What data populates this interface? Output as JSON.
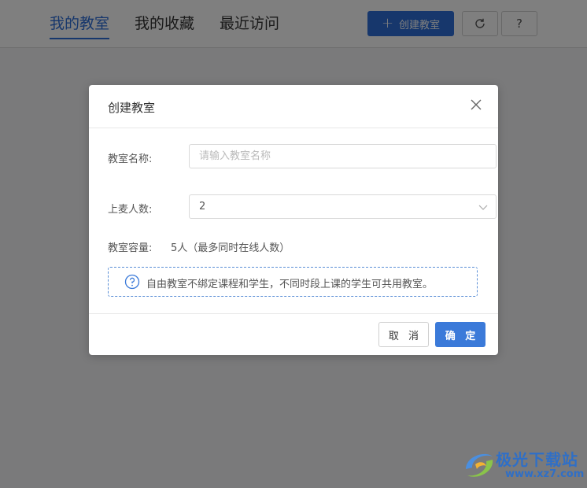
{
  "header": {
    "tabs": [
      {
        "label": "我的教室",
        "active": true
      },
      {
        "label": "我的收藏",
        "active": false
      },
      {
        "label": "最近访问",
        "active": false
      }
    ],
    "create_button_label": "创建教室",
    "refresh_icon": "refresh-icon",
    "help_label": "?"
  },
  "modal": {
    "title": "创建教室",
    "name_label": "教室名称:",
    "name_placeholder": "请输入教室名称",
    "name_value": "",
    "seats_label": "上麦人数:",
    "seats_value": "2",
    "capacity_label": "教室容量:",
    "capacity_value": "5人（最多同时在线人数）",
    "notice": "自由教室不绑定课程和学生，不同时段上课的学生可共用教室。",
    "cancel_label": "取 消",
    "ok_label": "确 定"
  },
  "watermark": {
    "name": "极光下载站",
    "url": "www.xz7.com"
  },
  "colors": {
    "accent": "#2e6fd8",
    "ok_button": "#3b7ad9",
    "overlay": "rgba(0,0,0,0.5)"
  }
}
